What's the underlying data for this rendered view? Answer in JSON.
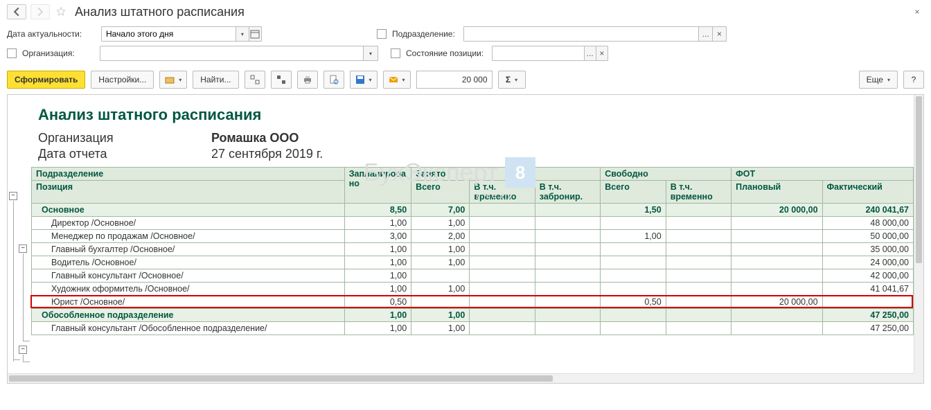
{
  "titlebar": {
    "title": "Анализ штатного расписания"
  },
  "params": {
    "date_label": "Дата актуальности:",
    "date_value": "Начало этого дня",
    "division_label": "Подразделение:",
    "division_value": "",
    "division_clear": "×",
    "division_more": "...",
    "org_label": "Организация:",
    "org_value": "",
    "state_label": "Состояние позиции:",
    "state_value": "",
    "state_more": "...",
    "state_clear": "×"
  },
  "toolbar": {
    "form": "Сформировать",
    "settings": "Настройки...",
    "find": "Найти...",
    "number": "20 000",
    "more": "Еще",
    "help": "?"
  },
  "report": {
    "title": "Анализ штатного расписания",
    "meta": {
      "org_k": "Организация",
      "org_v": "Ромашка ООО",
      "date_k": "Дата отчета",
      "date_v": "27 сентября 2019 г."
    },
    "watermark": "БухЭксперт",
    "watermark_num": "8",
    "watermark_sub": "ов  по  учёту  в",
    "headers": {
      "division": "Подразделение",
      "position": "Позиция",
      "planned": "Запланировано",
      "busy": "Занято",
      "busy_all": "Всего",
      "busy_temp": "В т.ч. временно",
      "busy_res": "В т.ч. забронир.",
      "free": "Свободно",
      "free_all": "Всего",
      "free_temp": "В т.ч. временно",
      "fot": "ФОТ",
      "fot_plan": "Плановый",
      "fot_fact": "Фактический"
    },
    "groups": [
      {
        "name": "Основное",
        "planned": "8,50",
        "busy_all": "7,00",
        "free_all": "1,50",
        "fot_plan": "20 000,00",
        "fot_fact": "240 041,67",
        "rows": [
          {
            "name": "Директор /Основное/",
            "planned": "1,00",
            "busy_all": "1,00",
            "fot_fact": "48 000,00"
          },
          {
            "name": "Менеджер по продажам /Основное/",
            "planned": "3,00",
            "busy_all": "2,00",
            "free_all": "1,00",
            "fot_fact": "50 000,00"
          },
          {
            "name": "Главный бухгалтер /Основное/",
            "planned": "1,00",
            "busy_all": "1,00",
            "fot_fact": "35 000,00"
          },
          {
            "name": "Водитель /Основное/",
            "planned": "1,00",
            "busy_all": "1,00",
            "fot_fact": "24 000,00"
          },
          {
            "name": "Главный консультант /Основное/",
            "planned": "1,00",
            "fot_fact": "42 000,00"
          },
          {
            "name": "Художник оформитель /Основное/",
            "planned": "1,00",
            "busy_all": "1,00",
            "fot_fact": "41 041,67"
          },
          {
            "name": "Юрист /Основное/",
            "planned": "0,50",
            "free_all": "0,50",
            "fot_plan": "20 000,00",
            "highlight": true
          }
        ]
      },
      {
        "name": "Обособленное подразделение",
        "planned": "1,00",
        "busy_all": "1,00",
        "fot_fact": "47 250,00",
        "rows": [
          {
            "name": "Главный консультант /Обособленное подразделение/",
            "planned": "1,00",
            "busy_all": "1,00",
            "fot_fact": "47 250,00"
          }
        ]
      }
    ]
  }
}
